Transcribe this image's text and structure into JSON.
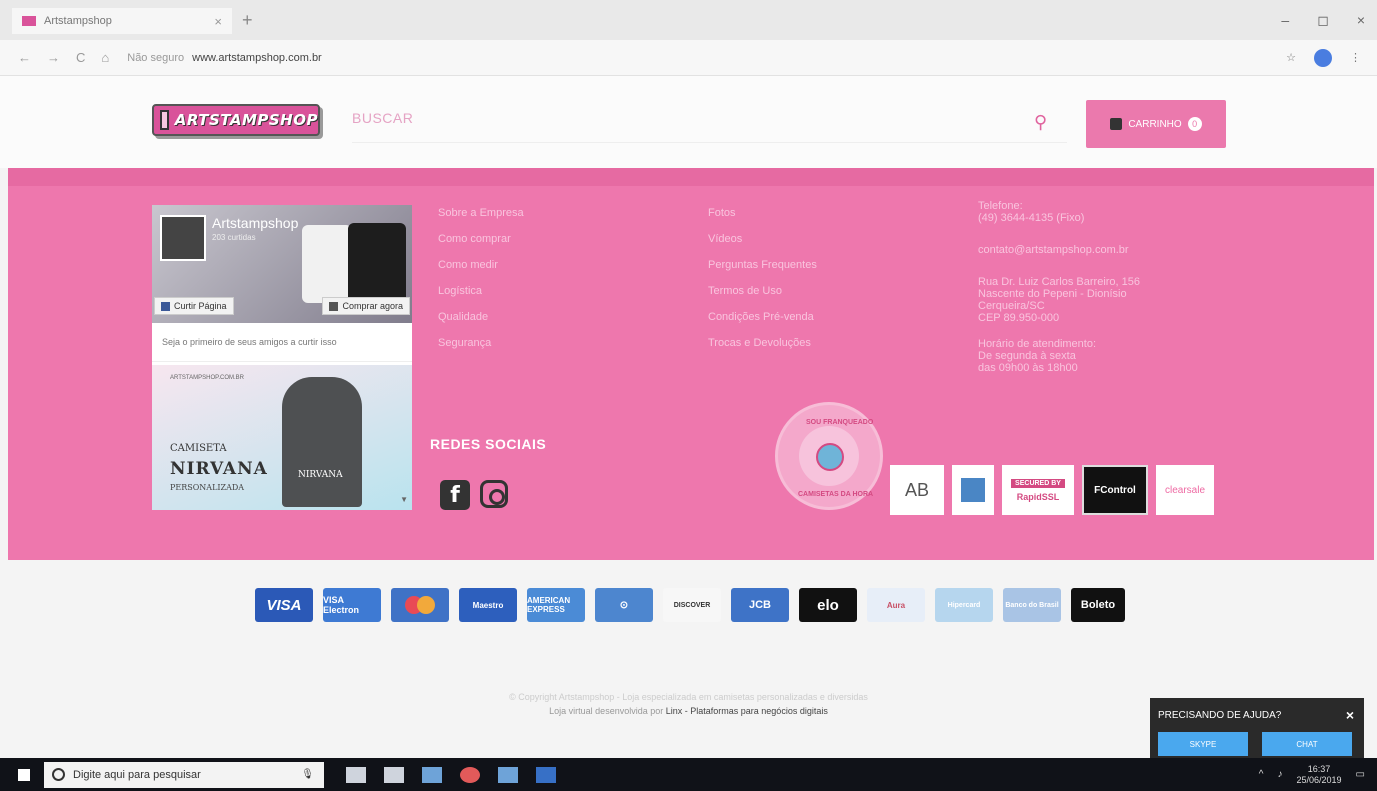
{
  "browser": {
    "tab_title": "Artstampshop",
    "tab_close": "×",
    "new_tab": "+",
    "win_min": "–",
    "win_max": "◻",
    "win_close": "×",
    "nav_back": "←",
    "nav_forward": "→",
    "nav_reload": "C",
    "nav_home": "⌂",
    "security_text": "Não seguro",
    "url": "www.artstampshop.com.br"
  },
  "header": {
    "logo_text": "ARTSTAMPSHOP",
    "search_placeholder": "BUSCAR",
    "cart_label": "CARRINHO",
    "cart_count": "0"
  },
  "facebook_widget": {
    "page_name": "Artstampshop",
    "followers": "203 curtidas",
    "like_button": "Curtir Página",
    "buy_button": "Comprar agora",
    "friends_text": "Seja o primeiro de seus amigos a curtir isso",
    "post_caption_top": "ARTSTAMPSHOP.COM.BR",
    "post_line1": "CAMISETA",
    "post_line2": "NIRVANA",
    "post_line3": "PERSONALIZADA",
    "post_shirt_label": "NIRVANA"
  },
  "links_col1": [
    "Sobre a Empresa",
    "Como comprar",
    "Como medir",
    "Logística",
    "Qualidade",
    "Segurança"
  ],
  "links_col2": [
    "Fotos",
    "Vídeos",
    "Perguntas Frequentes",
    "Termos de Uso",
    "Condições Pré-venda",
    "Trocas e Devoluções"
  ],
  "contact": {
    "phone_label": "Telefone:",
    "phone": "(49) 3644-4135 (Fixo)",
    "email": "contato@artstampshop.com.br",
    "address1": "Rua Dr. Luiz Carlos Barreiro, 156",
    "address2": "Nascente do Pepeni - Dionísio",
    "address3": "Cerqueira/SC",
    "address4": "CEP 89.950-000",
    "hours_label": "Horário de atendimento:",
    "hours1": "De segunda à sexta",
    "hours2": "das 09h00 às 18h00"
  },
  "social": {
    "heading": "REDES SOCIAIS",
    "facebook_glyph": "f"
  },
  "badge": {
    "text_top": "SOU FRANQUEADO",
    "text_bottom": "CAMISETAS DA HORA"
  },
  "seals": {
    "ab": "AB",
    "ssl_top": "SECURED BY",
    "ssl_bottom": "RapidSSL",
    "fcontrol": "FControl",
    "clearsale": "clearsale"
  },
  "payments": {
    "visa": "VISA",
    "visa_electron": "VISA Electron",
    "maestro": "Maestro",
    "amex": "AMERICAN EXPRESS",
    "discover": "DISCOVER",
    "jcb": "JCB",
    "elo": "elo",
    "aura": "Aura",
    "hipercard": "Hipercard",
    "bb": "Banco do Brasil",
    "boleto": "Boleto"
  },
  "footer": {
    "copyright": "© Copyright Artstampshop - Loja especializada em camisetas personalizadas e diversidas",
    "dev_prefix": "Loja virtual desenvolvida por",
    "dev_name": "Linx - Plataformas para negócios digitais"
  },
  "help_widget": {
    "title": "PRECISANDO DE AJUDA?",
    "close": "×",
    "skype": "SKYPE",
    "chat": "CHAT"
  },
  "taskbar": {
    "search_placeholder": "Digite aqui para pesquisar",
    "time": "16:37",
    "date": "25/06/2019"
  }
}
